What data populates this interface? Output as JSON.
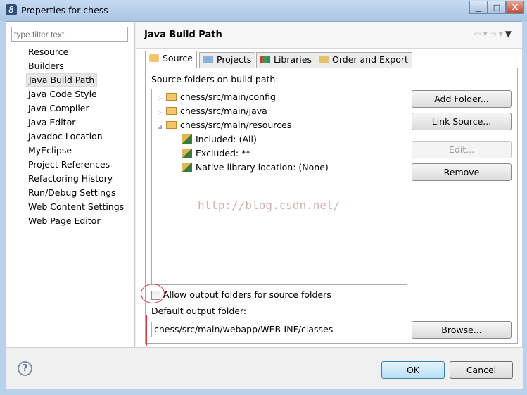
{
  "window": {
    "title": "Properties for chess",
    "icon": "eclipse-app-icon",
    "controls": [
      "minimize",
      "maximize",
      "close"
    ]
  },
  "sidebar": {
    "filter_placeholder": "type filter text",
    "items": [
      {
        "label": "Resource"
      },
      {
        "label": "Builders"
      },
      {
        "label": "Java Build Path",
        "selected": true
      },
      {
        "label": "Java Code Style"
      },
      {
        "label": "Java Compiler"
      },
      {
        "label": "Java Editor"
      },
      {
        "label": "Javadoc Location"
      },
      {
        "label": "MyEclipse"
      },
      {
        "label": "Project References"
      },
      {
        "label": "Refactoring History"
      },
      {
        "label": "Run/Debug Settings"
      },
      {
        "label": "Web Content Settings"
      },
      {
        "label": "Web Page Editor"
      }
    ]
  },
  "page": {
    "title": "Java Build Path",
    "tabs": [
      {
        "label": "Source",
        "active": true
      },
      {
        "label": "Projects"
      },
      {
        "label": "Libraries"
      },
      {
        "label": "Order and Export"
      }
    ],
    "source_label": "Source folders on build path:",
    "tree": [
      {
        "label": "chess/src/main/config",
        "level": 0,
        "expanded": false
      },
      {
        "label": "chess/src/main/java",
        "level": 0,
        "expanded": false
      },
      {
        "label": "chess/src/main/resources",
        "level": 0,
        "expanded": true
      },
      {
        "label": "Included: (All)",
        "level": 1
      },
      {
        "label": "Excluded: **",
        "level": 1
      },
      {
        "label": "Native library location: (None)",
        "level": 1
      }
    ],
    "buttons": {
      "add_folder": "Add Folder...",
      "link_source": "Link Source...",
      "edit": "Edit...",
      "remove": "Remove",
      "browse": "Browse..."
    },
    "allow_output_label": "Allow output folders for source folders",
    "allow_output_checked": false,
    "default_output_label": "Default output folder:",
    "default_output_value": "chess/src/main/webapp/WEB-INF/classes",
    "watermark": "http://blog.csdn.net/"
  },
  "footer": {
    "ok": "OK",
    "cancel": "Cancel"
  },
  "colors": {
    "annotation": "#dd3333",
    "ok_accent": "#3c7fb1"
  }
}
